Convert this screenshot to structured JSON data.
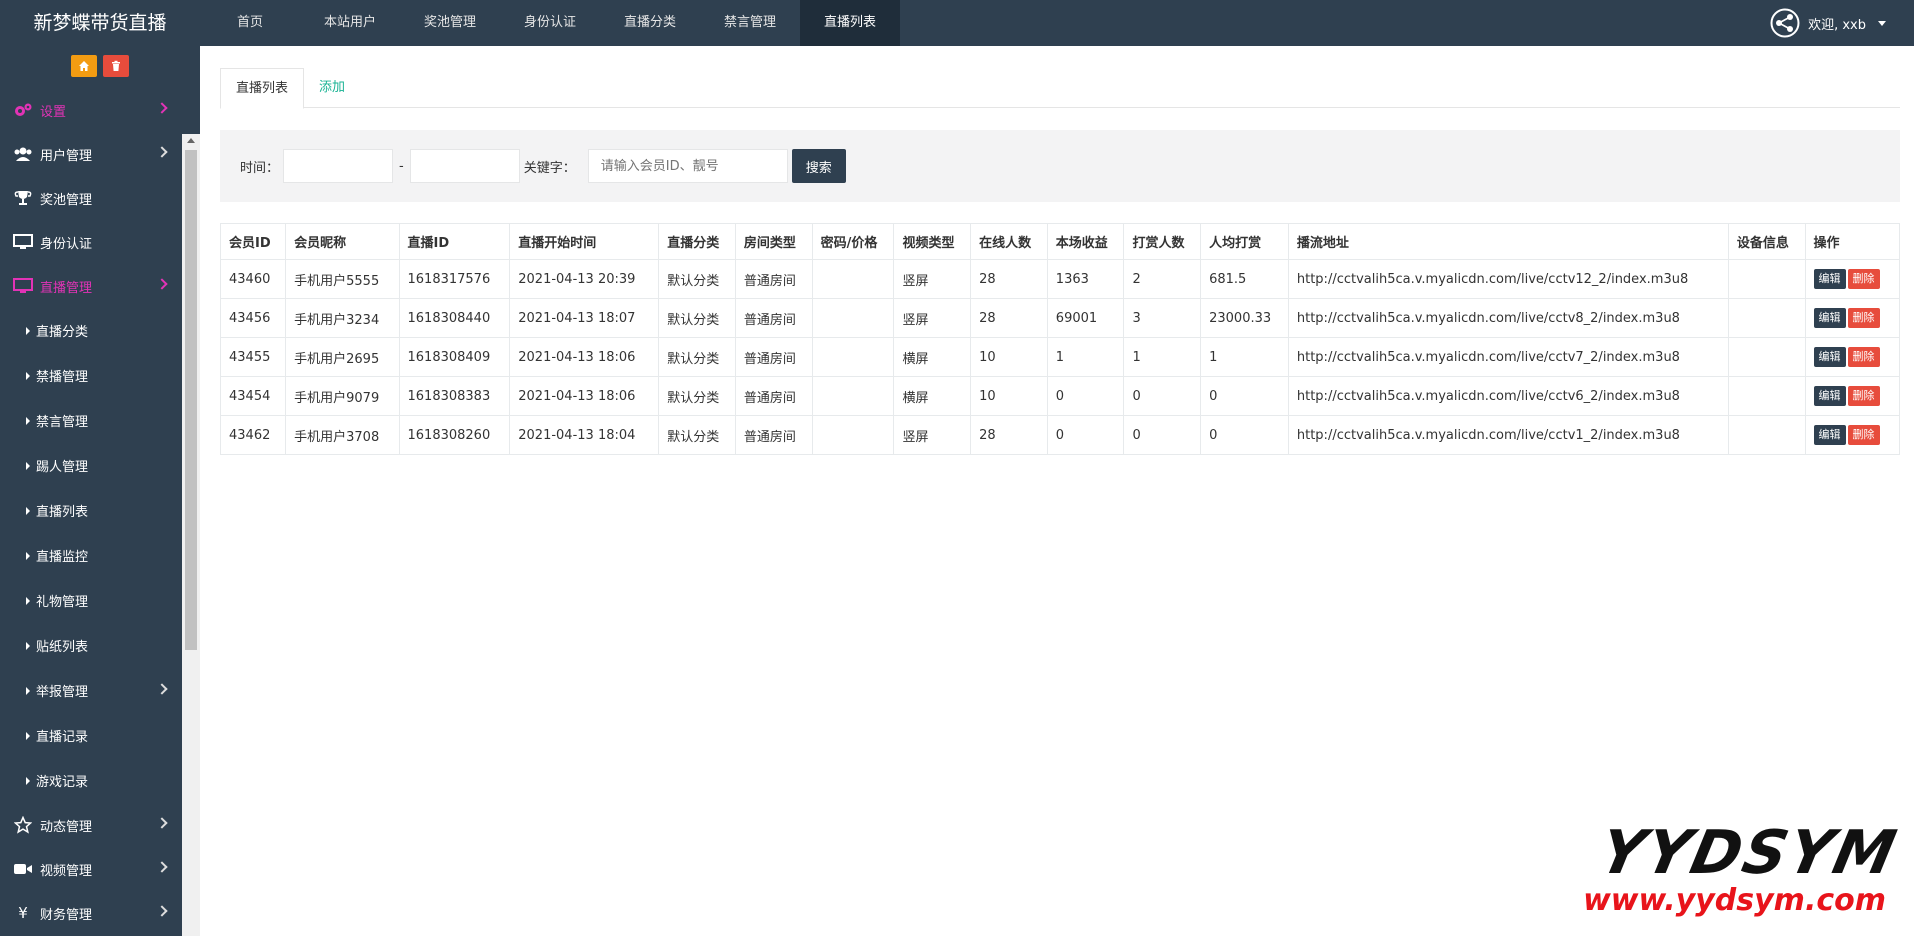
{
  "brand": "新梦蝶带货直播",
  "topnav": [
    "首页",
    "本站用户",
    "奖池管理",
    "身份认证",
    "直播分类",
    "禁言管理",
    "直播列表"
  ],
  "topnav_active": 6,
  "user": {
    "welcome": "欢迎, xxb"
  },
  "sidebar": {
    "menu": [
      {
        "label": "设置",
        "icon": "gears-icon"
      },
      {
        "label": "用户管理",
        "icon": "users-icon"
      },
      {
        "label": "奖池管理",
        "icon": "trophy-icon"
      },
      {
        "label": "身份认证",
        "icon": "monitor-icon"
      },
      {
        "label": "直播管理",
        "icon": "monitor-icon"
      }
    ],
    "sub": [
      "直播分类",
      "禁播管理",
      "禁言管理",
      "踢人管理",
      "直播列表",
      "直播监控",
      "礼物管理",
      "贴纸列表",
      "举报管理",
      "直播记录",
      "游戏记录"
    ],
    "menu2": [
      {
        "label": "动态管理",
        "icon": "star-icon"
      },
      {
        "label": "视频管理",
        "icon": "video-icon"
      },
      {
        "label": "财务管理",
        "icon": "yen-icon"
      }
    ]
  },
  "tabs": {
    "list": "直播列表",
    "add": "添加"
  },
  "filter": {
    "time_label": "时间：",
    "dash": "-",
    "keyword_label": "关键字：",
    "keyword_placeholder": "请输入会员ID、靓号",
    "search_button": "搜索"
  },
  "table": {
    "headers": [
      "会员ID",
      "会员昵称",
      "直播ID",
      "直播开始时间",
      "直播分类",
      "房间类型",
      "密码/价格",
      "视频类型",
      "在线人数",
      "本场收益",
      "打赏人数",
      "人均打赏",
      "播流地址",
      "设备信息",
      "操作"
    ],
    "rows": [
      [
        "43460",
        "手机用户5555",
        "1618317576",
        "2021-04-13 20:39",
        "默认分类",
        "普通房间",
        "",
        "竖屏",
        "28",
        "1363",
        "2",
        "681.5",
        "http://cctvalih5ca.v.myalicdn.com/live/cctv12_2/index.m3u8",
        ""
      ],
      [
        "43456",
        "手机用户3234",
        "1618308440",
        "2021-04-13 18:07",
        "默认分类",
        "普通房间",
        "",
        "竖屏",
        "28",
        "69001",
        "3",
        "23000.33",
        "http://cctvalih5ca.v.myalicdn.com/live/cctv8_2/index.m3u8",
        ""
      ],
      [
        "43455",
        "手机用户2695",
        "1618308409",
        "2021-04-13 18:06",
        "默认分类",
        "普通房间",
        "",
        "横屏",
        "10",
        "1",
        "1",
        "1",
        "http://cctvalih5ca.v.myalicdn.com/live/cctv7_2/index.m3u8",
        ""
      ],
      [
        "43454",
        "手机用户9079",
        "1618308383",
        "2021-04-13 18:06",
        "默认分类",
        "普通房间",
        "",
        "横屏",
        "10",
        "0",
        "0",
        "0",
        "http://cctvalih5ca.v.myalicdn.com/live/cctv6_2/index.m3u8",
        ""
      ],
      [
        "43462",
        "手机用户3708",
        "1618308260",
        "2021-04-13 18:04",
        "默认分类",
        "普通房间",
        "",
        "竖屏",
        "28",
        "0",
        "0",
        "0",
        "http://cctvalih5ca.v.myalicdn.com/live/cctv1_2/index.m3u8",
        ""
      ]
    ],
    "actions": {
      "edit": "编辑",
      "delete": "删除"
    }
  },
  "watermark": {
    "logo": "YYDSYM",
    "url": "www.yydsym.com"
  },
  "colors": {
    "dark": "#2f4050",
    "magenta": "#e233b6",
    "green": "#1ab394",
    "red": "#e74c3c",
    "orange": "#f39c12"
  }
}
